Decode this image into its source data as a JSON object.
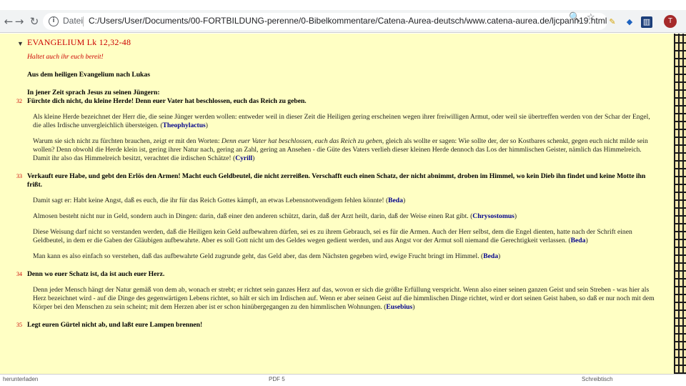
{
  "browser": {
    "back_glyph": "←",
    "forward_glyph": "→",
    "reload_glyph": "↻",
    "scheme": "Datei",
    "url": "C:/Users/User/Documents/00-FORTBILDUNG-perenne/0-Bibelkommentare/Catena-Aurea-deutsch/www.catena-aurea.de/ljcpann19.html",
    "avatar_letter": "T"
  },
  "page": {
    "title": "EVANGELIUM   Lk 12,32-48",
    "tagline": "Haltet auch ihr euch bereit!",
    "heading": "Aus dem heiligen Evangelium nach Lukas",
    "intro": "In jener Zeit sprach Jesus zu seinen Jüngern:",
    "verse32": {
      "num": "32",
      "text": "Fürchte dich nicht, du kleine Herde! Denn euer Vater hat beschlossen, euch das Reich zu geben.",
      "c1_text": "Als kleine Herde bezeichnet der Herr die, die seine Jünger werden wollen: entweder weil in dieser Zeit die Heiligen gering erscheinen wegen ihrer freiwilligen Armut, oder weil sie übertreffen werden von der Schar der Engel, die alles Irdische unvergleichlich übersteigen.",
      "c1_author": "Theophylactus",
      "c2_text_a": "Warum sie sich nicht zu fürchten brauchen, zeigt er mit den Worten:",
      "c2_quote": "Denn euer Vater hat beschlossen, euch das Reich zu geben,",
      "c2_text_b": "gleich als wollte er sagen: Wie sollte der, der so Kostbares schenkt, gegen euch nicht milde sein wollen? Denn obwohl die Herde klein ist, gering ihrer Natur nach, gering an Zahl, gering an Ansehen - die Güte des Vaters verlieh dieser kleinen Herde dennoch das Los der himmlischen Geister, nämlich das Himmelreich. Damit ihr also das Himmelreich besitzt, verachtet die irdischen Schätze!",
      "c2_author": "Cyrill"
    },
    "verse33": {
      "num": "33",
      "text": "Verkauft eure Habe, und gebt den Erlös den Armen! Macht euch Geldbeutel, die nicht zerreißen. Verschafft euch einen Schatz, der nicht abnimmt, droben im Himmel, wo kein Dieb ihn findet und keine Motte ihn frißt.",
      "c1_text": "Damit sagt er: Habt keine Angst, daß es euch, die ihr für das Reich Gottes kämpft, an etwas Lebensnotwendigem fehlen könnte!",
      "c1_author": "Beda",
      "c2_text": "Almosen besteht nicht nur in Geld, sondern auch in Dingen: darin, daß einer den anderen schützt, darin, daß der Arzt heilt, darin, daß der Weise einen Rat gibt.",
      "c2_author": "Chrysostomus",
      "c3_text": "Diese Weisung darf nicht so verstanden werden, daß die Heiligen kein Geld aufbewahren dürfen, sei es zu ihrem Gebrauch, sei es für die Armen. Auch der Herr selbst, dem die Engel dienten, hatte nach der Schrift einen Geldbeutel, in dem er die Gaben der Gläubigen aufbewahrte. Aber es soll Gott nicht um des Geldes wegen gedient werden, und aus Angst vor der Armut soll niemand die Gerechtigkeit verlassen.",
      "c3_author": "Beda",
      "c4_text": "Man kann es also einfach so verstehen, daß das aufbewahrte Geld zugrunde geht, das Geld aber, das dem Nächsten gegeben wird, ewige Frucht bringt im Himmel.",
      "c4_author": "Beda"
    },
    "verse34": {
      "num": "34",
      "text": "Denn wo euer Schatz ist, da ist auch euer Herz.",
      "c1_text": "Denn jeder Mensch hängt der Natur gemäß von dem ab, wonach er strebt; er richtet sein ganzes Herz auf das, wovon er sich die größte Erfüllung verspricht. Wenn also einer seinen ganzen Geist und sein Streben - was hier als Herz bezeichnet wird - auf die Dinge des gegenwärtigen Lebens richtet, so hält er sich im Irdischen auf. Wenn er aber seinen Geist auf die himmlischen Dinge richtet, wird er dort seinen Geist haben, so daß er nur noch mit dem Körper bei den Menschen zu sein scheint; mit dem Herzen aber ist er schon hinübergegangen zu den himmlischen Wohnungen.",
      "c1_author": "Eusebius"
    },
    "verse35": {
      "num": "35",
      "text": "Legt euren Gürtel nicht ab, und laßt eure Lampen brennen!"
    }
  },
  "taskbar": {
    "item1": "herunterladen",
    "item2": "PDF 5",
    "item3": "Schreibtisch"
  }
}
